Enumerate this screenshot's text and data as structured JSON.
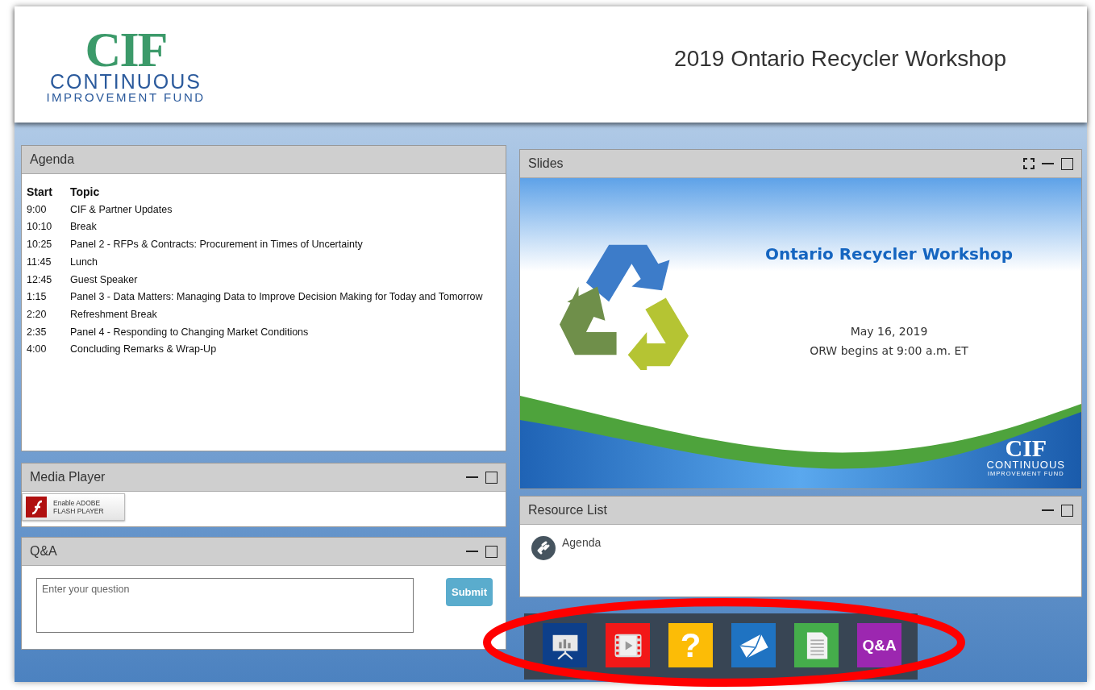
{
  "header": {
    "logo": {
      "mark": "CIF",
      "line1": "CONTINUOUS",
      "line2": "IMPROVEMENT FUND"
    },
    "title": "2019 Ontario Recycler Workshop"
  },
  "agenda": {
    "title": "Agenda",
    "columns": [
      "Start",
      "Topic"
    ],
    "rows": [
      {
        "start": "9:00",
        "topic": "CIF & Partner Updates"
      },
      {
        "start": "10:10",
        "topic": "Break"
      },
      {
        "start": "10:25",
        "topic": "Panel 2 - RFPs & Contracts: Procurement in Times of Uncertainty"
      },
      {
        "start": "11:45",
        "topic": "Lunch"
      },
      {
        "start": "12:45",
        "topic": "Guest Speaker"
      },
      {
        "start": "1:15",
        "topic": "Panel 3 - Data Matters: Managing Data to Improve Decision Making for Today and Tomorrow"
      },
      {
        "start": "2:20",
        "topic": "Refreshment Break"
      },
      {
        "start": "2:35",
        "topic": "Panel 4 - Responding to Changing Market Conditions"
      },
      {
        "start": "4:00",
        "topic": "Concluding Remarks & Wrap-Up"
      }
    ]
  },
  "media_player": {
    "title": "Media Player",
    "controls": [
      {
        "kind": "minimize"
      },
      {
        "kind": "maximize"
      }
    ],
    "flash_button": {
      "line1": "Enable ADOBE",
      "line2": "FLASH PLAYER"
    }
  },
  "qa": {
    "title": "Q&A",
    "controls": [
      {
        "kind": "minimize"
      },
      {
        "kind": "maximize"
      }
    ],
    "placeholder": "Enter your question",
    "submit": "Submit"
  },
  "slides": {
    "title": "Slides",
    "controls": [
      {
        "kind": "fullscreen"
      },
      {
        "kind": "minimize"
      },
      {
        "kind": "maximize"
      }
    ],
    "slide": {
      "title": "Ontario Recycler Workshop",
      "date": "May 16, 2019",
      "time": "ORW begins at 9:00 a.m. ET",
      "logo": {
        "mark": "CIF",
        "line1": "CONTINUOUS",
        "line2": "IMPROVEMENT FUND"
      }
    }
  },
  "resource_list": {
    "title": "Resource List",
    "controls": [
      {
        "kind": "minimize"
      },
      {
        "kind": "maximize"
      }
    ],
    "items": [
      {
        "label": "Agenda"
      }
    ]
  },
  "dock": [
    {
      "kind": "presentation",
      "color": "#0d3f8a"
    },
    {
      "kind": "video",
      "color": "#f21818"
    },
    {
      "kind": "help",
      "color": "#fcbc06",
      "label": "?"
    },
    {
      "kind": "mail",
      "color": "#1f73c2"
    },
    {
      "kind": "document",
      "color": "#45ad4b"
    },
    {
      "kind": "qa",
      "color": "#9c27b0",
      "label": "Q&A"
    }
  ]
}
